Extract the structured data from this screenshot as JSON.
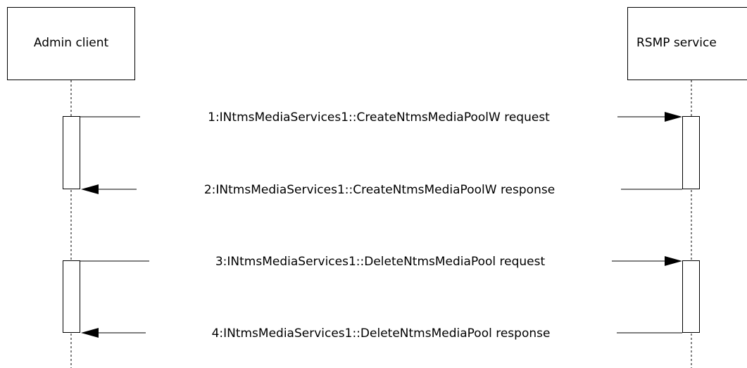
{
  "participants": {
    "client": {
      "label": "Admin client"
    },
    "server": {
      "label": "RSMP service"
    }
  },
  "messages": [
    {
      "label": "1:INtmsMediaServices1::CreateNtmsMediaPoolW request",
      "direction": "client-to-server"
    },
    {
      "label": "2:INtmsMediaServices1::CreateNtmsMediaPoolW response",
      "direction": "server-to-client"
    },
    {
      "label": "3:INtmsMediaServices1::DeleteNtmsMediaPool request",
      "direction": "client-to-server"
    },
    {
      "label": "4:INtmsMediaServices1::DeleteNtmsMediaPool response",
      "direction": "server-to-client"
    }
  ]
}
